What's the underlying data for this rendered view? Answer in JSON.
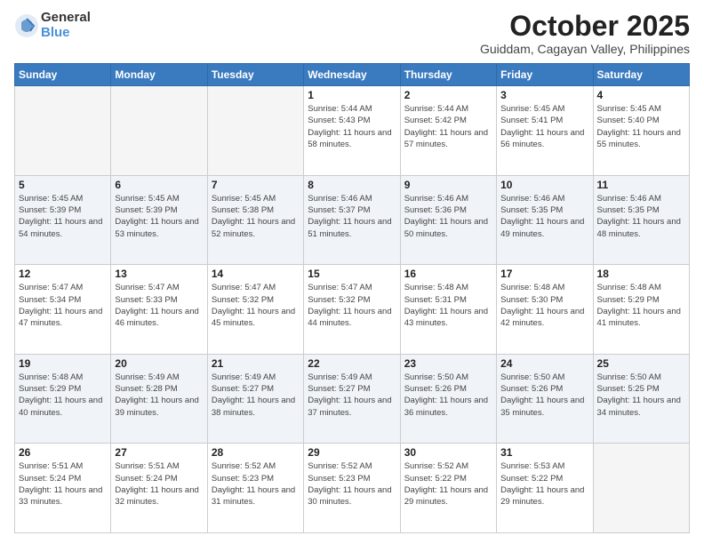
{
  "logo": {
    "general": "General",
    "blue": "Blue"
  },
  "header": {
    "month": "October 2025",
    "location": "Guiddam, Cagayan Valley, Philippines"
  },
  "weekdays": [
    "Sunday",
    "Monday",
    "Tuesday",
    "Wednesday",
    "Thursday",
    "Friday",
    "Saturday"
  ],
  "weeks": [
    [
      {
        "day": "",
        "sunrise": "",
        "sunset": "",
        "daylight": ""
      },
      {
        "day": "",
        "sunrise": "",
        "sunset": "",
        "daylight": ""
      },
      {
        "day": "",
        "sunrise": "",
        "sunset": "",
        "daylight": ""
      },
      {
        "day": "1",
        "sunrise": "Sunrise: 5:44 AM",
        "sunset": "Sunset: 5:43 PM",
        "daylight": "Daylight: 11 hours and 58 minutes."
      },
      {
        "day": "2",
        "sunrise": "Sunrise: 5:44 AM",
        "sunset": "Sunset: 5:42 PM",
        "daylight": "Daylight: 11 hours and 57 minutes."
      },
      {
        "day": "3",
        "sunrise": "Sunrise: 5:45 AM",
        "sunset": "Sunset: 5:41 PM",
        "daylight": "Daylight: 11 hours and 56 minutes."
      },
      {
        "day": "4",
        "sunrise": "Sunrise: 5:45 AM",
        "sunset": "Sunset: 5:40 PM",
        "daylight": "Daylight: 11 hours and 55 minutes."
      }
    ],
    [
      {
        "day": "5",
        "sunrise": "Sunrise: 5:45 AM",
        "sunset": "Sunset: 5:39 PM",
        "daylight": "Daylight: 11 hours and 54 minutes."
      },
      {
        "day": "6",
        "sunrise": "Sunrise: 5:45 AM",
        "sunset": "Sunset: 5:39 PM",
        "daylight": "Daylight: 11 hours and 53 minutes."
      },
      {
        "day": "7",
        "sunrise": "Sunrise: 5:45 AM",
        "sunset": "Sunset: 5:38 PM",
        "daylight": "Daylight: 11 hours and 52 minutes."
      },
      {
        "day": "8",
        "sunrise": "Sunrise: 5:46 AM",
        "sunset": "Sunset: 5:37 PM",
        "daylight": "Daylight: 11 hours and 51 minutes."
      },
      {
        "day": "9",
        "sunrise": "Sunrise: 5:46 AM",
        "sunset": "Sunset: 5:36 PM",
        "daylight": "Daylight: 11 hours and 50 minutes."
      },
      {
        "day": "10",
        "sunrise": "Sunrise: 5:46 AM",
        "sunset": "Sunset: 5:35 PM",
        "daylight": "Daylight: 11 hours and 49 minutes."
      },
      {
        "day": "11",
        "sunrise": "Sunrise: 5:46 AM",
        "sunset": "Sunset: 5:35 PM",
        "daylight": "Daylight: 11 hours and 48 minutes."
      }
    ],
    [
      {
        "day": "12",
        "sunrise": "Sunrise: 5:47 AM",
        "sunset": "Sunset: 5:34 PM",
        "daylight": "Daylight: 11 hours and 47 minutes."
      },
      {
        "day": "13",
        "sunrise": "Sunrise: 5:47 AM",
        "sunset": "Sunset: 5:33 PM",
        "daylight": "Daylight: 11 hours and 46 minutes."
      },
      {
        "day": "14",
        "sunrise": "Sunrise: 5:47 AM",
        "sunset": "Sunset: 5:32 PM",
        "daylight": "Daylight: 11 hours and 45 minutes."
      },
      {
        "day": "15",
        "sunrise": "Sunrise: 5:47 AM",
        "sunset": "Sunset: 5:32 PM",
        "daylight": "Daylight: 11 hours and 44 minutes."
      },
      {
        "day": "16",
        "sunrise": "Sunrise: 5:48 AM",
        "sunset": "Sunset: 5:31 PM",
        "daylight": "Daylight: 11 hours and 43 minutes."
      },
      {
        "day": "17",
        "sunrise": "Sunrise: 5:48 AM",
        "sunset": "Sunset: 5:30 PM",
        "daylight": "Daylight: 11 hours and 42 minutes."
      },
      {
        "day": "18",
        "sunrise": "Sunrise: 5:48 AM",
        "sunset": "Sunset: 5:29 PM",
        "daylight": "Daylight: 11 hours and 41 minutes."
      }
    ],
    [
      {
        "day": "19",
        "sunrise": "Sunrise: 5:48 AM",
        "sunset": "Sunset: 5:29 PM",
        "daylight": "Daylight: 11 hours and 40 minutes."
      },
      {
        "day": "20",
        "sunrise": "Sunrise: 5:49 AM",
        "sunset": "Sunset: 5:28 PM",
        "daylight": "Daylight: 11 hours and 39 minutes."
      },
      {
        "day": "21",
        "sunrise": "Sunrise: 5:49 AM",
        "sunset": "Sunset: 5:27 PM",
        "daylight": "Daylight: 11 hours and 38 minutes."
      },
      {
        "day": "22",
        "sunrise": "Sunrise: 5:49 AM",
        "sunset": "Sunset: 5:27 PM",
        "daylight": "Daylight: 11 hours and 37 minutes."
      },
      {
        "day": "23",
        "sunrise": "Sunrise: 5:50 AM",
        "sunset": "Sunset: 5:26 PM",
        "daylight": "Daylight: 11 hours and 36 minutes."
      },
      {
        "day": "24",
        "sunrise": "Sunrise: 5:50 AM",
        "sunset": "Sunset: 5:26 PM",
        "daylight": "Daylight: 11 hours and 35 minutes."
      },
      {
        "day": "25",
        "sunrise": "Sunrise: 5:50 AM",
        "sunset": "Sunset: 5:25 PM",
        "daylight": "Daylight: 11 hours and 34 minutes."
      }
    ],
    [
      {
        "day": "26",
        "sunrise": "Sunrise: 5:51 AM",
        "sunset": "Sunset: 5:24 PM",
        "daylight": "Daylight: 11 hours and 33 minutes."
      },
      {
        "day": "27",
        "sunrise": "Sunrise: 5:51 AM",
        "sunset": "Sunset: 5:24 PM",
        "daylight": "Daylight: 11 hours and 32 minutes."
      },
      {
        "day": "28",
        "sunrise": "Sunrise: 5:52 AM",
        "sunset": "Sunset: 5:23 PM",
        "daylight": "Daylight: 11 hours and 31 minutes."
      },
      {
        "day": "29",
        "sunrise": "Sunrise: 5:52 AM",
        "sunset": "Sunset: 5:23 PM",
        "daylight": "Daylight: 11 hours and 30 minutes."
      },
      {
        "day": "30",
        "sunrise": "Sunrise: 5:52 AM",
        "sunset": "Sunset: 5:22 PM",
        "daylight": "Daylight: 11 hours and 29 minutes."
      },
      {
        "day": "31",
        "sunrise": "Sunrise: 5:53 AM",
        "sunset": "Sunset: 5:22 PM",
        "daylight": "Daylight: 11 hours and 29 minutes."
      },
      {
        "day": "",
        "sunrise": "",
        "sunset": "",
        "daylight": ""
      }
    ]
  ]
}
